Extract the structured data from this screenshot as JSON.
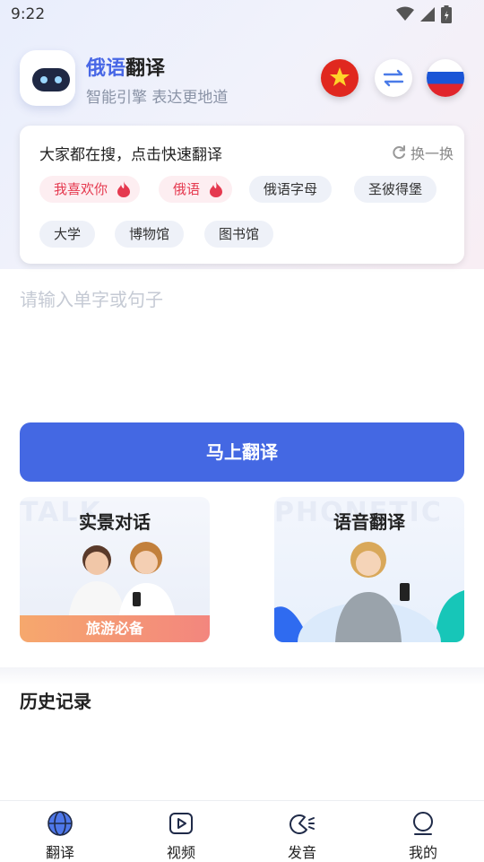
{
  "status": {
    "time": "9:22"
  },
  "header": {
    "title_accent": "俄语",
    "title_rest": "翻译",
    "subtitle": "智能引擎 表达更地道",
    "source_lang_flag": "china-flag",
    "target_lang_flag": "russia-flag",
    "swap_icon": "swap-arrows-icon"
  },
  "search_card": {
    "title": "大家都在搜，点击快速翻译",
    "refresh_label": "换一换",
    "chips": [
      {
        "label": "我喜欢你",
        "hot": true
      },
      {
        "label": "俄语",
        "hot": true
      },
      {
        "label": "俄语字母",
        "hot": false
      },
      {
        "label": "圣彼得堡",
        "hot": false
      },
      {
        "label": "大学",
        "hot": false
      },
      {
        "label": "博物馆",
        "hot": false
      },
      {
        "label": "图书馆",
        "hot": false
      }
    ]
  },
  "input": {
    "placeholder": "请输入单字或句子"
  },
  "translate_button": "马上翻译",
  "features": [
    {
      "title": "实景对话",
      "bg_word": "TALK",
      "tag": "旅游必备"
    },
    {
      "title": "语音翻译",
      "bg_word": "PHONETIC",
      "tag": ""
    }
  ],
  "history": {
    "title": "历史记录"
  },
  "nav": [
    {
      "label": "翻译",
      "icon": "globe-icon",
      "active": true
    },
    {
      "label": "视频",
      "icon": "play-icon",
      "active": false
    },
    {
      "label": "发音",
      "icon": "pronounce-icon",
      "active": false
    },
    {
      "label": "我的",
      "icon": "user-icon",
      "active": false
    }
  ],
  "colors": {
    "accent": "#4468e3",
    "hot": "#e5394f"
  }
}
